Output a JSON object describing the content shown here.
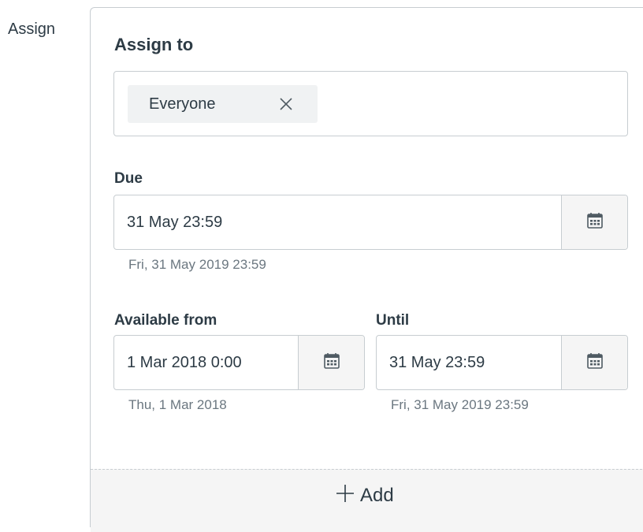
{
  "side_label": "Assign",
  "card": {
    "title": "Assign to",
    "assignees": [
      {
        "label": "Everyone",
        "remove_icon": "close-icon"
      }
    ],
    "due": {
      "label": "Due",
      "value": "31 May 23:59",
      "hint": "Fri, 31 May 2019 23:59",
      "icon": "calendar-icon"
    },
    "available_from": {
      "label": "Available from",
      "value": "1 Mar 2018 0:00",
      "hint": "Thu, 1 Mar 2018",
      "icon": "calendar-icon"
    },
    "until": {
      "label": "Until",
      "value": "31 May 23:59",
      "hint": "Fri, 31 May 2019 23:59",
      "icon": "calendar-icon"
    }
  },
  "add_button": {
    "label": "Add",
    "icon": "plus-icon"
  },
  "colors": {
    "text": "#2d3b45",
    "hint_text": "#6b7780",
    "border": "#c7cdd1",
    "token_bg": "#f0f2f3",
    "button_bg": "#f5f5f5"
  }
}
